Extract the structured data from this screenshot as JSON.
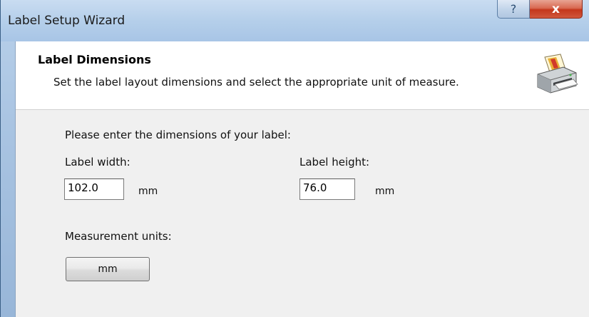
{
  "window": {
    "title": "Label Setup Wizard",
    "help_glyph": "?",
    "close_glyph": "x"
  },
  "header": {
    "title": "Label Dimensions",
    "subtitle": "Set the label layout dimensions and select the appropriate unit of measure.",
    "icon": "printer-icon"
  },
  "form": {
    "prompt": "Please enter the dimensions of your label:",
    "width_label": "Label width:",
    "width_value": "102.0",
    "width_unit": "mm",
    "height_label": "Label height:",
    "height_value": "76.0",
    "height_unit": "mm",
    "units_label": "Measurement units:",
    "units_button": "mm"
  },
  "colors": {
    "close_button": "#c4371c",
    "client_background": "#f0f0f0",
    "header_background": "#ffffff"
  }
}
